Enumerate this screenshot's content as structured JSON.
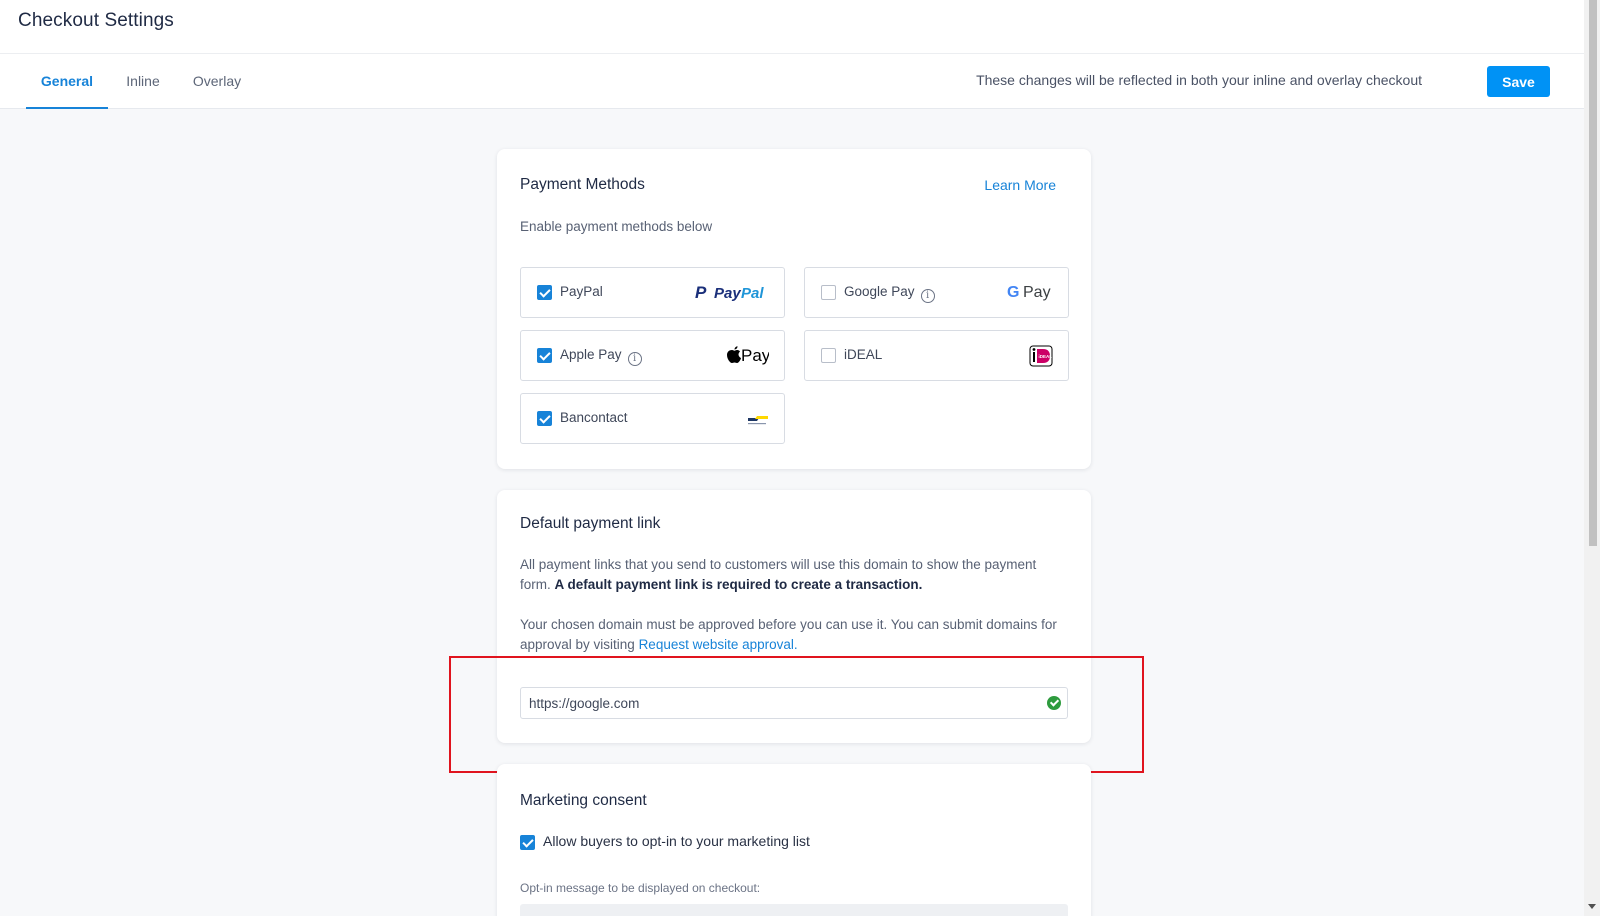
{
  "header": {
    "title": "Checkout Settings"
  },
  "tabs": [
    {
      "label": "General",
      "active": true
    },
    {
      "label": "Inline",
      "active": false
    },
    {
      "label": "Overlay",
      "active": false
    }
  ],
  "toolbar": {
    "notice": "These changes will be reflected in both your inline and overlay checkout",
    "save_label": "Save"
  },
  "payment_methods": {
    "title": "Payment Methods",
    "learn_more": "Learn More",
    "subtitle": "Enable payment methods below",
    "items": [
      {
        "label": "PayPal",
        "checked": true,
        "info": false,
        "logo": "PayPal",
        "icon": "paypal-logo-icon"
      },
      {
        "label": "Google Pay",
        "checked": false,
        "info": true,
        "logo": "Pay",
        "icon": "google-pay-logo-icon"
      },
      {
        "label": "Apple Pay",
        "checked": true,
        "info": true,
        "logo": "Pay",
        "icon": "apple-pay-logo-icon"
      },
      {
        "label": "iDEAL",
        "checked": false,
        "info": false,
        "logo": "iDEAL",
        "icon": "ideal-logo-icon"
      },
      {
        "label": "Bancontact",
        "checked": true,
        "info": false,
        "logo": "",
        "icon": "bancontact-logo-icon"
      }
    ]
  },
  "default_link": {
    "title": "Default payment link",
    "para1_normal": "All payment links that you send to customers will use this domain to show the payment form. ",
    "para1_bold": "A default payment link is required to create a transaction.",
    "para2": "Your chosen domain must be approved before you can use it. You can submit domains for approval by visiting ",
    "para2_link": "Request website approval.",
    "url_value": "https://google.com",
    "valid": true
  },
  "marketing": {
    "title": "Marketing consent",
    "checkbox_label": "Allow buyers to opt-in to your marketing list",
    "checked": true,
    "optin_label": "Opt-in message to be displayed on checkout:"
  },
  "colors": {
    "accent": "#1783d8",
    "save_button": "#0092f5",
    "valid": "#2e9b3e",
    "highlight": "#e0141e"
  }
}
